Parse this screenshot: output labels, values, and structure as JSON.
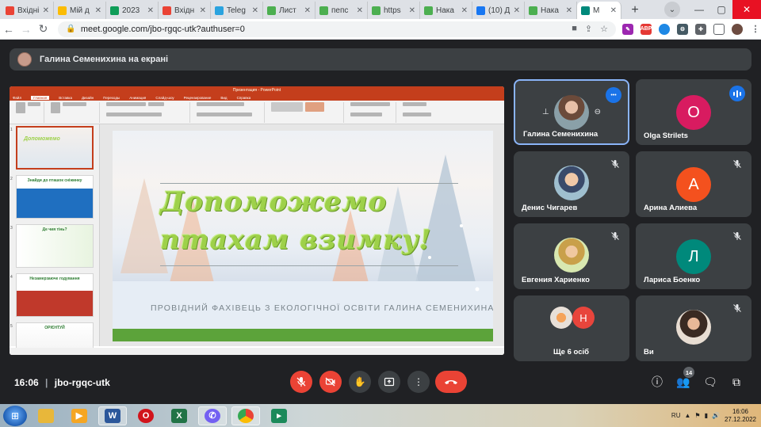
{
  "browser": {
    "tabs": [
      {
        "label": "Вхідні",
        "favicon_color": "#ea4335",
        "active": false
      },
      {
        "label": "Мій д",
        "favicon_color": "#fbbc04",
        "active": false
      },
      {
        "label": "2023",
        "favicon_color": "#0f9d58",
        "active": false
      },
      {
        "label": "Вхідн",
        "favicon_color": "#ea4335",
        "active": false
      },
      {
        "label": "Teleg",
        "favicon_color": "#2aa3df",
        "active": false
      },
      {
        "label": "Лист",
        "favicon_color": "#4caf50",
        "active": false
      },
      {
        "label": "пепс",
        "favicon_color": "#4caf50",
        "active": false
      },
      {
        "label": "https",
        "favicon_color": "#4caf50",
        "active": false
      },
      {
        "label": "Нака",
        "favicon_color": "#4caf50",
        "active": false
      },
      {
        "label": "(10) Д",
        "favicon_color": "#1877f2",
        "active": false
      },
      {
        "label": "Нака",
        "favicon_color": "#4caf50",
        "active": false
      },
      {
        "label": "М",
        "favicon_color": "#00897b",
        "active": true
      }
    ],
    "url": "meet.google.com/jbo-rgqc-utk?authuser=0"
  },
  "meet": {
    "presenting_label": "Галина Семенихина на екрані",
    "presentation": {
      "app_title": "Презентация - PowerPoint",
      "ribbon_tabs": [
        "Файл",
        "Главная",
        "Вставка",
        "Дизайн",
        "Переходы",
        "Анимация",
        "Слайд-шоу",
        "Рецензирование",
        "Вид",
        "Справка"
      ],
      "slide_title_line1": "Допоможемо",
      "slide_title_line2": "птахам взимку!",
      "slide_subtitle": "ПРОВІДНИЙ ФАХІВЕЦЬ З ЕКОЛОГІЧНОЇ ОСВІТИ ГАЛИНА СЕМЕНИХИНА",
      "thumbnails": [
        "1",
        "2",
        "3",
        "4",
        "5"
      ],
      "thumb_labels": [
        "",
        "Знайди до пташок сніжинку",
        "Де чия тінь?",
        "Незамерзаюче годування",
        "ОРІЄНТУЙ"
      ]
    },
    "participants": [
      {
        "name": "Галина Семенихина",
        "type": "photo",
        "state": "more"
      },
      {
        "name": "Olga Strilets",
        "initial": "O",
        "color": "#d81b60",
        "state": "speaking"
      },
      {
        "name": "Денис Чигарев",
        "type": "photo",
        "state": "muted"
      },
      {
        "name": "Арина Алиева",
        "initial": "A",
        "color": "#f4511e",
        "state": "muted"
      },
      {
        "name": "Евгения Хариенко",
        "type": "photo",
        "state": "muted"
      },
      {
        "name": "Лариса Боенко",
        "initial": "Л",
        "color": "#00897b",
        "state": "muted"
      },
      {
        "name": "Ще 6 осіб",
        "initial": "Н",
        "color": "#e8453c",
        "state": "group"
      },
      {
        "name": "Ви",
        "type": "photo",
        "state": "muted"
      }
    ],
    "bottom": {
      "time": "16:06",
      "separator": "|",
      "meeting_code": "jbo-rgqc-utk",
      "people_count": "14"
    }
  },
  "taskbar": {
    "time": "16:06",
    "date": "27.12.2022",
    "lang": "RU"
  },
  "colors": {
    "meet_bg": "#202124",
    "tile_bg": "#3c4043",
    "accent_red": "#ea4335",
    "accent_blue": "#1a73e8",
    "slide_title_green": "#9ed14a"
  }
}
